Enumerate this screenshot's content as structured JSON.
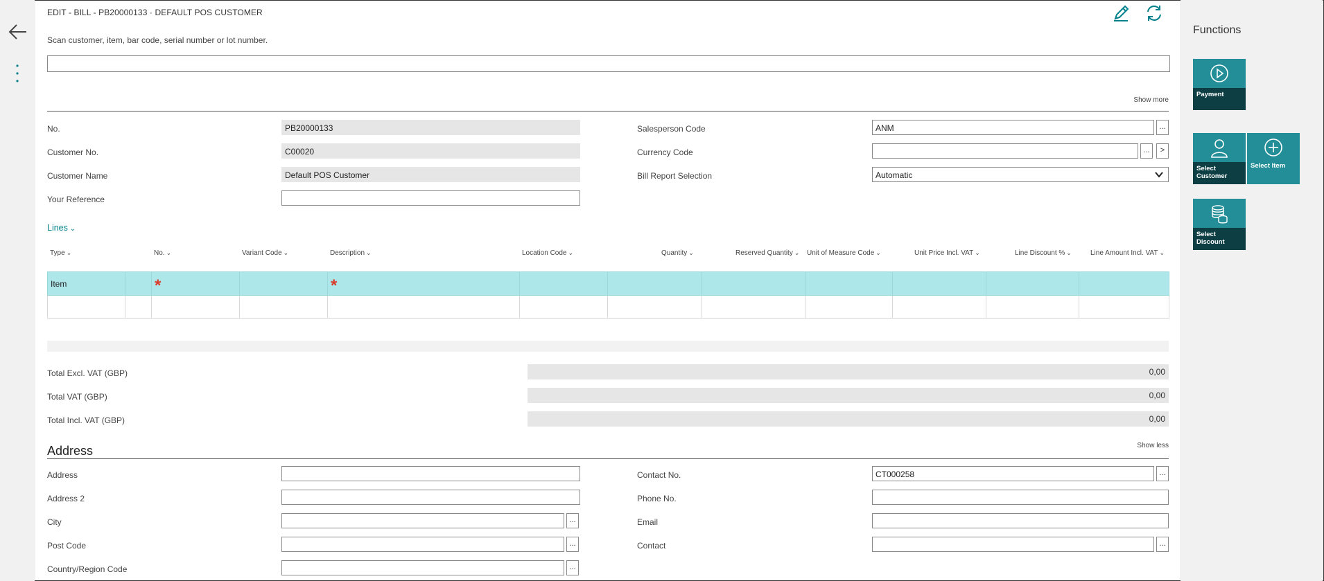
{
  "page": {
    "title": "EDIT - BILL - PB20000133 · DEFAULT POS CUSTOMER",
    "scan_label": "Scan customer, item, bar code, serial number or lot number.",
    "scan_value": "",
    "show_more": "Show more",
    "show_less": "Show less"
  },
  "fields": {
    "no_label": "No.",
    "no_value": "PB20000133",
    "customer_no_label": "Customer No.",
    "customer_no_value": "C00020",
    "customer_name_label": "Customer Name",
    "customer_name_value": "Default POS Customer",
    "your_reference_label": "Your Reference",
    "your_reference_value": "",
    "salesperson_label": "Salesperson Code",
    "salesperson_value": "ANM",
    "currency_label": "Currency Code",
    "currency_value": "",
    "bill_report_label": "Bill Report Selection",
    "bill_report_value": "Automatic"
  },
  "lines": {
    "toggle_label": "Lines",
    "columns": [
      "Type",
      "No.",
      "Variant Code",
      "Description",
      "Location Code",
      "Quantity",
      "Reserved Quantity",
      "Unit of Measure Code",
      "Unit Price Incl. VAT",
      "Line Discount %",
      "Line Amount Incl. VAT"
    ],
    "row1_type": "Item"
  },
  "totals": {
    "excl_label": "Total Excl. VAT (GBP)",
    "excl_value": "0,00",
    "vat_label": "Total VAT (GBP)",
    "vat_value": "0,00",
    "incl_label": "Total Incl. VAT (GBP)",
    "incl_value": "0,00"
  },
  "address": {
    "section_title": "Address",
    "address_label": "Address",
    "address_value": "",
    "address2_label": "Address 2",
    "address2_value": "",
    "city_label": "City",
    "city_value": "",
    "post_code_label": "Post Code",
    "post_code_value": "",
    "country_label": "Country/Region Code",
    "country_value": "",
    "contact_no_label": "Contact No.",
    "contact_no_value": "CT000258",
    "phone_label": "Phone No.",
    "phone_value": "",
    "email_label": "Email",
    "email_value": "",
    "contact_label": "Contact",
    "contact_value": ""
  },
  "functions": {
    "title": "Functions",
    "payment": "Payment",
    "select_customer": "Select Customer",
    "select_item": "Select Item",
    "select_discount": "Select Discount"
  },
  "symbols": {
    "ellipsis": "...",
    "next": ">",
    "required": "*"
  },
  "colors": {
    "accent": "#00818b",
    "tile": "#238e97",
    "tile_dark": "#0d3e44",
    "selected_row": "#aee7ea",
    "required": "#d83b2a"
  },
  "icons": [
    "back-arrow-icon",
    "more-vertical-icon",
    "edit-pencil-icon",
    "refresh-icon",
    "play-circle-icon",
    "person-icon",
    "plus-circle-icon",
    "coins-icon",
    "chevron-down-icon"
  ]
}
